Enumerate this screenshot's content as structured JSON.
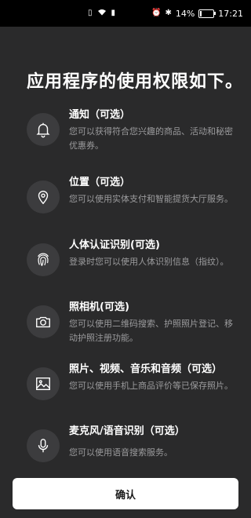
{
  "status_bar": {
    "time": "17:21",
    "battery": "14%",
    "battery_level": 0.14
  },
  "title": "应用程序的使用权限如下。",
  "permissions": [
    {
      "icon": "bell-icon",
      "title": "通知（可选）",
      "desc": "您可以获得符合您兴趣的商品、活动和秘密优惠券。"
    },
    {
      "icon": "location-pin-icon",
      "title": "位置（可选）",
      "desc": "您可以使用实体支付和智能提货大厅服务。"
    },
    {
      "icon": "fingerprint-icon",
      "title": "人体认证识别(可选)",
      "desc": "登录时您可以使用人体识别信息（指纹）。"
    },
    {
      "icon": "camera-icon",
      "title": "照相机(可选)",
      "desc": "您可以使用二维码搜索、护照照片登记、移动护照注册功能。"
    },
    {
      "icon": "image-icon",
      "title": "照片、视频、音乐和音频（可选）",
      "desc": "您可以使用手机上商品评价等已保存照片。"
    },
    {
      "icon": "microphone-icon",
      "title": "麦克风/语音识别（可选）",
      "desc": "您可以使用语音搜索服务。"
    }
  ],
  "confirm_label": "确认"
}
